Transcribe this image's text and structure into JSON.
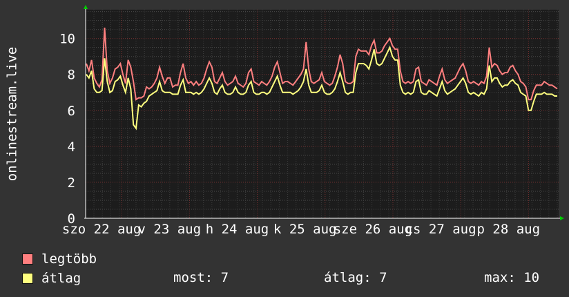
{
  "chart_data": {
    "type": "line",
    "ylabel": "onlinestream.live",
    "ylim": [
      0,
      11.6
    ],
    "yticks": [
      0,
      2,
      4,
      6,
      8,
      10
    ],
    "x_tick_labels": [
      "szo 22 aug",
      "v 23 aug",
      "h 24 aug",
      "k 25 aug",
      "sze 26 aug",
      "cs 27 aug",
      "p 28 aug"
    ],
    "grid": true,
    "series": [
      {
        "name": "legtöbb",
        "color": "#ff7f7f",
        "values": [
          8.6,
          8.2,
          8.8,
          7.8,
          7.5,
          7.3,
          7.7,
          10.6,
          8.2,
          7.5,
          7.8,
          8.3,
          8.4,
          8.6,
          8.0,
          7.5,
          8.8,
          8.4,
          7.6,
          6.6,
          6.7,
          6.7,
          6.8,
          7.3,
          7.2,
          7.3,
          7.5,
          7.8,
          8.4,
          7.9,
          7.5,
          7.8,
          7.8,
          7.3,
          7.4,
          7.4,
          8.1,
          8.6,
          7.8,
          7.5,
          7.6,
          7.4,
          7.6,
          7.4,
          7.5,
          7.8,
          8.3,
          8.7,
          8.4,
          7.6,
          7.5,
          7.8,
          8.1,
          7.6,
          7.4,
          7.5,
          7.6,
          7.9,
          7.5,
          7.4,
          7.3,
          7.5,
          8.1,
          8.3,
          7.6,
          7.5,
          7.4,
          7.6,
          7.5,
          7.4,
          7.6,
          7.9,
          8.4,
          8.7,
          8.1,
          7.5,
          7.6,
          7.6,
          7.5,
          7.4,
          7.6,
          7.8,
          8.0,
          8.3,
          9.8,
          8.3,
          7.6,
          7.5,
          7.6,
          7.7,
          8.1,
          7.6,
          7.5,
          7.4,
          7.5,
          7.9,
          8.4,
          9.1,
          8.6,
          7.6,
          7.5,
          7.5,
          7.6,
          9.0,
          9.4,
          9.3,
          9.3,
          9.3,
          9.1,
          9.6,
          9.9,
          9.2,
          9.2,
          9.3,
          9.6,
          9.8,
          10.0,
          9.6,
          9.4,
          9.4,
          8.2,
          7.6,
          7.5,
          7.6,
          7.5,
          7.6,
          8.3,
          8.4,
          7.6,
          7.5,
          7.4,
          7.7,
          7.6,
          7.5,
          7.4,
          7.9,
          8.3,
          7.7,
          7.5,
          7.6,
          7.7,
          7.8,
          8.1,
          8.4,
          8.6,
          8.2,
          7.6,
          7.5,
          7.6,
          7.5,
          7.4,
          7.6,
          7.5,
          7.9,
          9.5,
          8.4,
          8.6,
          8.5,
          8.2,
          8.0,
          8.1,
          8.1,
          8.4,
          8.5,
          8.2,
          8.0,
          7.6,
          7.5,
          7.3,
          6.6,
          6.6,
          7.1,
          7.4,
          7.4,
          7.4,
          7.6,
          7.5,
          7.4,
          7.4,
          7.3,
          7.2
        ]
      },
      {
        "name": "átlag",
        "color": "#ffff7f",
        "values": [
          8.0,
          7.8,
          8.2,
          7.2,
          7.0,
          7.0,
          7.1,
          8.9,
          7.6,
          7.0,
          7.1,
          7.6,
          7.7,
          7.9,
          7.4,
          7.0,
          7.8,
          7.2,
          5.2,
          5.0,
          6.3,
          6.2,
          6.4,
          6.5,
          6.8,
          6.9,
          7.0,
          7.1,
          7.6,
          7.1,
          7.0,
          7.0,
          7.0,
          6.9,
          6.9,
          6.9,
          7.4,
          7.7,
          7.0,
          7.0,
          7.0,
          6.9,
          7.0,
          6.9,
          7.0,
          7.2,
          7.5,
          7.8,
          7.5,
          7.0,
          6.9,
          7.2,
          7.4,
          7.0,
          6.9,
          6.9,
          7.0,
          7.3,
          7.0,
          6.9,
          6.9,
          7.0,
          7.4,
          7.6,
          7.0,
          6.9,
          6.9,
          7.0,
          7.0,
          6.9,
          7.0,
          7.3,
          7.6,
          7.9,
          7.4,
          7.0,
          7.0,
          7.0,
          7.0,
          6.9,
          7.0,
          7.1,
          7.3,
          7.6,
          8.3,
          7.4,
          7.0,
          7.0,
          7.0,
          7.1,
          7.4,
          7.0,
          6.9,
          6.9,
          7.0,
          7.2,
          7.6,
          8.1,
          7.6,
          7.0,
          6.9,
          7.0,
          7.0,
          8.1,
          8.6,
          8.6,
          8.6,
          8.5,
          8.3,
          8.8,
          9.4,
          8.6,
          8.5,
          8.6,
          8.9,
          9.2,
          9.5,
          9.0,
          8.8,
          8.8,
          7.4,
          7.0,
          6.9,
          7.0,
          6.9,
          7.0,
          7.6,
          7.7,
          7.0,
          6.9,
          6.9,
          7.1,
          7.0,
          6.9,
          6.8,
          7.2,
          7.6,
          7.1,
          6.9,
          7.0,
          7.1,
          7.2,
          7.4,
          7.6,
          7.8,
          7.5,
          7.0,
          6.9,
          7.0,
          6.9,
          6.8,
          7.0,
          6.9,
          7.2,
          8.5,
          7.6,
          7.8,
          7.8,
          7.5,
          7.3,
          7.4,
          7.4,
          7.6,
          7.7,
          7.5,
          7.4,
          7.0,
          6.9,
          6.8,
          6.0,
          6.0,
          6.5,
          6.9,
          6.9,
          6.9,
          7.0,
          6.9,
          6.9,
          6.9,
          6.8,
          6.8
        ]
      }
    ]
  },
  "legend": {
    "max_label": "legtöbb",
    "avg_label": "átlag",
    "max_color": "#ff7f7f",
    "avg_color": "#ffff7f"
  },
  "stats": {
    "now": "most: 7",
    "average": "átlag: 7",
    "maximum": "max: 10"
  }
}
